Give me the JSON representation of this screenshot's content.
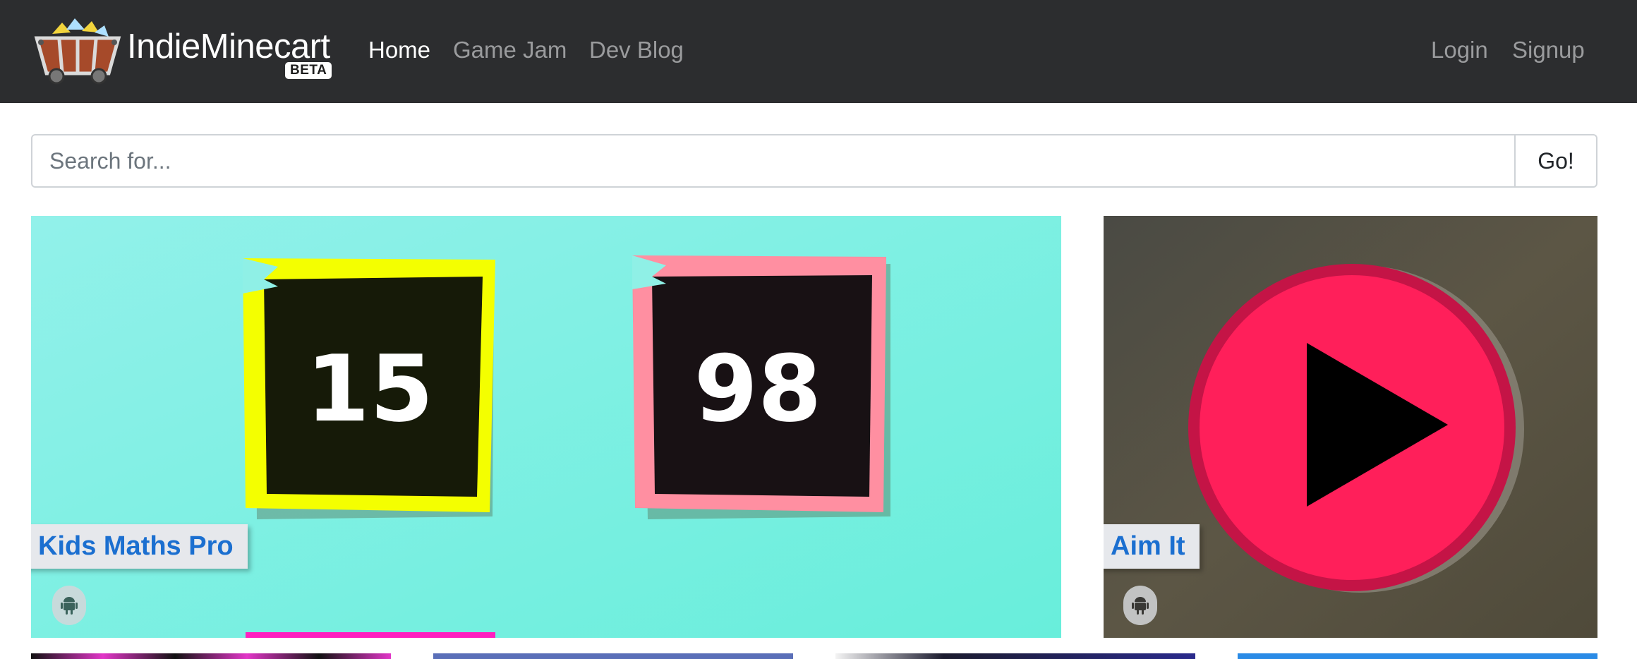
{
  "brand": {
    "name": "IndieMinecart",
    "badge": "BETA"
  },
  "nav": {
    "home": "Home",
    "game_jam": "Game Jam",
    "dev_blog": "Dev Blog",
    "login": "Login",
    "signup": "Signup"
  },
  "search": {
    "placeholder": "Search for...",
    "value": "",
    "button": "Go!"
  },
  "games": [
    {
      "title": "Kids Maths Pro",
      "platform": "android-icon",
      "art_numbers": [
        "15",
        "98"
      ]
    },
    {
      "title": "Aim It",
      "platform": "android-icon",
      "art": "play-icon"
    }
  ],
  "colors": {
    "navbar": "#2c2d2f",
    "link_accent": "#1b6fd0",
    "kids_bg": "#7eeee3",
    "aim_bg": "#5b5443",
    "play_red": "#ff1f5a"
  }
}
